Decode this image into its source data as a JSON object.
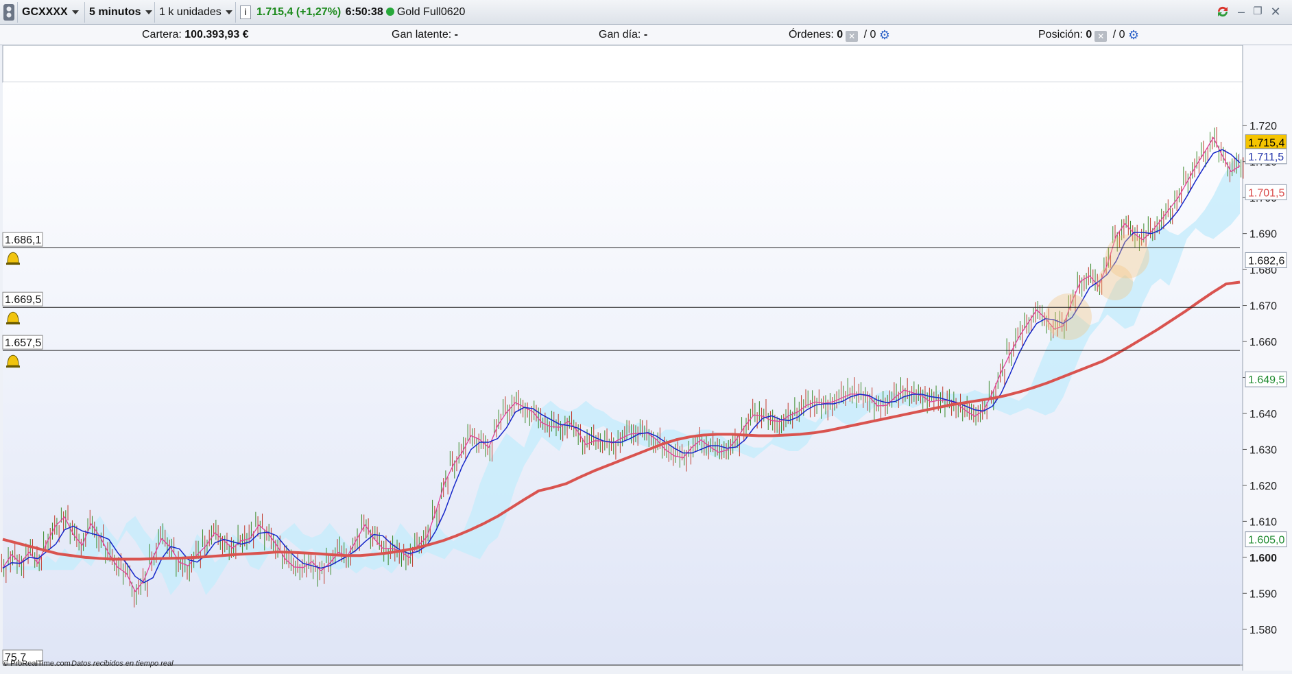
{
  "toolbar": {
    "symbol": "GCXXXX",
    "timeframe": "5 minutos",
    "units": "1 k unidades",
    "info_icon": "i",
    "price_change": "1.715,4 (+1,27%)",
    "clock": "6:50:38",
    "instrument": "Gold Full0620",
    "status_color": "#27a83a",
    "window_icons": [
      "sync-icon",
      "minimize-icon",
      "restore-icon",
      "close-icon"
    ]
  },
  "account": {
    "cartera_label": "Cartera:",
    "cartera_value": "100.393,93 €",
    "gan_latente_label": "Gan latente:",
    "gan_latente_value": "-",
    "gan_dia_label": "Gan día:",
    "gan_dia_value": "-",
    "ordenes_label": "Órdenes:",
    "ordenes_value": "0",
    "ordenes_value2": "/ 0",
    "posicion_label": "Posición:",
    "posicion_value": "0",
    "posicion_value2": "/ 0"
  },
  "footer": {
    "copyright": "© ProRealTime.com",
    "realtime": "Datos recibidos en tiempo real"
  },
  "chart_data": {
    "type": "line",
    "ylim": [
      1575,
      1725
    ],
    "y_ticks": [
      {
        "value": 1720,
        "label": "1.720"
      },
      {
        "value": 1710,
        "label": "1.710"
      },
      {
        "value": 1700,
        "label": "1.700"
      },
      {
        "value": 1690,
        "label": "1.690"
      },
      {
        "value": 1680,
        "label": "1.680"
      },
      {
        "value": 1670,
        "label": "1.670"
      },
      {
        "value": 1660,
        "label": "1.660"
      },
      {
        "value": 1650,
        "label": "1.650"
      },
      {
        "value": 1640,
        "label": "1.640"
      },
      {
        "value": 1630,
        "label": "1.630"
      },
      {
        "value": 1620,
        "label": "1.620"
      },
      {
        "value": 1610,
        "label": "1.610"
      },
      {
        "value": 1600,
        "label": "1.600"
      },
      {
        "value": 1590,
        "label": "1.590"
      },
      {
        "value": 1580,
        "label": "1.580"
      }
    ],
    "price_tags": [
      {
        "value": 1715.4,
        "label": "1.715,4",
        "bg": "#f5c400",
        "fg": "#000000"
      },
      {
        "value": 1711.5,
        "label": "1.711,5",
        "bg": "#ffffff",
        "fg": "#2233aa"
      },
      {
        "value": 1701.5,
        "label": "1.701,5",
        "bg": "#ffffff",
        "fg": "#d94a4a"
      },
      {
        "value": 1682.6,
        "label": "1.682,6",
        "bg": "#ffffff",
        "fg": "#111111"
      },
      {
        "value": 1649.5,
        "label": "1.649,5",
        "bg": "#ffffff",
        "fg": "#1e8a2e"
      },
      {
        "value": 1605.0,
        "label": "1.605,0",
        "bg": "#ffffff",
        "fg": "#1e8a2e"
      }
    ],
    "alert_lines": [
      {
        "value": 1686.1,
        "label": "1.686,1"
      },
      {
        "value": 1669.5,
        "label": "1.669,5"
      },
      {
        "value": 1657.5,
        "label": "1.657,5"
      },
      {
        "value": 1575.7,
        "label": "75,7"
      }
    ],
    "series": [
      {
        "name": "price",
        "color": "#3a8a2a",
        "values": [
          1597,
          1600,
          1598,
          1602,
          1599,
          1604,
          1608,
          1611,
          1607,
          1604,
          1609,
          1605,
          1601,
          1598,
          1596,
          1590,
          1593,
          1600,
          1606,
          1603,
          1598,
          1597,
          1601,
          1604,
          1607,
          1604,
          1602,
          1605,
          1606,
          1609,
          1606,
          1603,
          1600,
          1598,
          1597,
          1598,
          1596,
          1599,
          1602,
          1600,
          1604,
          1609,
          1606,
          1603,
          1602,
          1601,
          1600,
          1604,
          1606,
          1612,
          1620,
          1626,
          1630,
          1634,
          1632,
          1630,
          1637,
          1641,
          1643,
          1641,
          1640,
          1638,
          1637,
          1636,
          1637,
          1635,
          1632,
          1633,
          1632,
          1631,
          1633,
          1635,
          1635,
          1634,
          1632,
          1630,
          1629,
          1628,
          1630,
          1632,
          1631,
          1630,
          1630,
          1632,
          1636,
          1640,
          1640,
          1638,
          1637,
          1639,
          1641,
          1643,
          1643,
          1642,
          1643,
          1645,
          1646,
          1645,
          1644,
          1642,
          1643,
          1645,
          1646,
          1645,
          1645,
          1644,
          1644,
          1643,
          1642,
          1641,
          1640,
          1641,
          1645,
          1651,
          1657,
          1662,
          1665,
          1668,
          1666,
          1664,
          1665,
          1671,
          1676,
          1678,
          1676,
          1682,
          1689,
          1692,
          1690,
          1689,
          1691,
          1693,
          1696,
          1700,
          1705,
          1709,
          1712,
          1716,
          1712,
          1708,
          1709
        ]
      },
      {
        "name": "ma_red",
        "color": "#d9534f",
        "values": [
          1605,
          1604,
          1603,
          1602,
          1601,
          1600.5,
          1600,
          1599.7,
          1599.5,
          1599.5,
          1599.5,
          1599.6,
          1599.7,
          1599.8,
          1600,
          1600.2,
          1600.5,
          1600.8,
          1601,
          1601.2,
          1601.5,
          1601.4,
          1601.2,
          1601,
          1600.7,
          1600.5,
          1600.5,
          1600.8,
          1601.2,
          1601.8,
          1602.5,
          1603.5,
          1604.6,
          1606,
          1607.6,
          1609.4,
          1611.4,
          1613.8,
          1616.2,
          1618.5,
          1619.4,
          1620.5,
          1622.3,
          1624,
          1625.5,
          1627,
          1628.5,
          1630,
          1631.5,
          1632.7,
          1633.5,
          1634,
          1634.2,
          1634.2,
          1634,
          1633.8,
          1633.8,
          1634,
          1634.2,
          1634.6,
          1635.2,
          1636,
          1636.8,
          1637.6,
          1638.4,
          1639.2,
          1640,
          1640.8,
          1641.6,
          1642.4,
          1643,
          1643.6,
          1644.2,
          1645,
          1646,
          1647.2,
          1648.5,
          1650,
          1651.5,
          1653,
          1654.5,
          1656.5,
          1658.7,
          1661,
          1663.3,
          1665.8,
          1668.3,
          1671,
          1673.6,
          1676,
          1676.5
        ]
      }
    ]
  }
}
